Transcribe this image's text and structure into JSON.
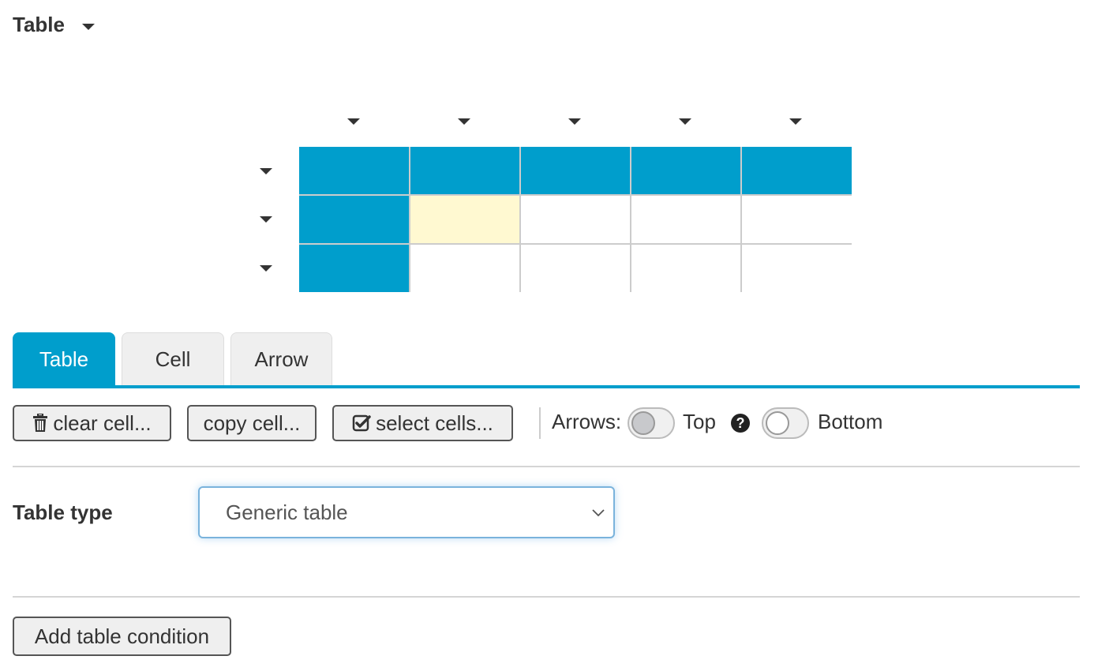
{
  "header": {
    "title": "Table",
    "title_menu_icon": "caret-down-icon"
  },
  "table_preview": {
    "columns": 5,
    "rows": 3,
    "column_menu_icon": "caret-down-icon",
    "row_menu_icon": "caret-down-icon",
    "colors": {
      "header": "#009ecc",
      "selected": "#fff9d1",
      "empty": "#ffffff",
      "grid_line": "#cccccc"
    },
    "cells": [
      [
        "header",
        "header",
        "header",
        "header",
        "header"
      ],
      [
        "header",
        "selected",
        "empty",
        "empty",
        "empty"
      ],
      [
        "header",
        "empty",
        "empty",
        "empty",
        "empty"
      ]
    ]
  },
  "tabs": [
    {
      "label": "Table",
      "active": true
    },
    {
      "label": "Cell",
      "active": false
    },
    {
      "label": "Arrow",
      "active": false
    }
  ],
  "toolbar": {
    "clear_label": "clear cell...",
    "clear_icon": "trash-icon",
    "copy_label": "copy cell...",
    "select_label": "select cells...",
    "select_icon": "checkbox-icon",
    "arrows_label": "Arrows:",
    "top_label": "Top",
    "top_on": false,
    "help_icon": "question-circle-icon",
    "help_glyph": "?",
    "bottom_label": "Bottom",
    "bottom_on": false
  },
  "table_type": {
    "label": "Table type",
    "value": "Generic table"
  },
  "actions": {
    "add_condition_label": "Add table condition"
  },
  "accent_color": "#009ecc"
}
